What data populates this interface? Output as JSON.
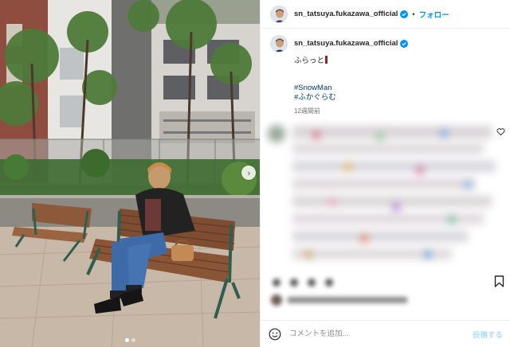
{
  "post": {
    "username": "sn_tatsuya.fukazawa_official",
    "follow_label": "フォロー",
    "separator": "•",
    "caption_text": "ふらっと",
    "hashtags": [
      "#SnowMan",
      "#ふかぐらむ"
    ],
    "time_ago": "12週間前",
    "carousel": {
      "slide_count": 2,
      "active_index": 0
    }
  },
  "comment_box": {
    "placeholder": "コメントを追加...",
    "post_label": "投稿する"
  },
  "icons": {
    "verified": "verified-badge-icon",
    "next": "chevron-right-icon",
    "heart": "heart-outline-icon",
    "bookmark": "bookmark-icon",
    "emoji": "smiley-icon"
  },
  "colors": {
    "link": "#00376b",
    "follow": "#0095f6",
    "verified": "#0095f6",
    "post_disabled": "#b2dffc"
  }
}
